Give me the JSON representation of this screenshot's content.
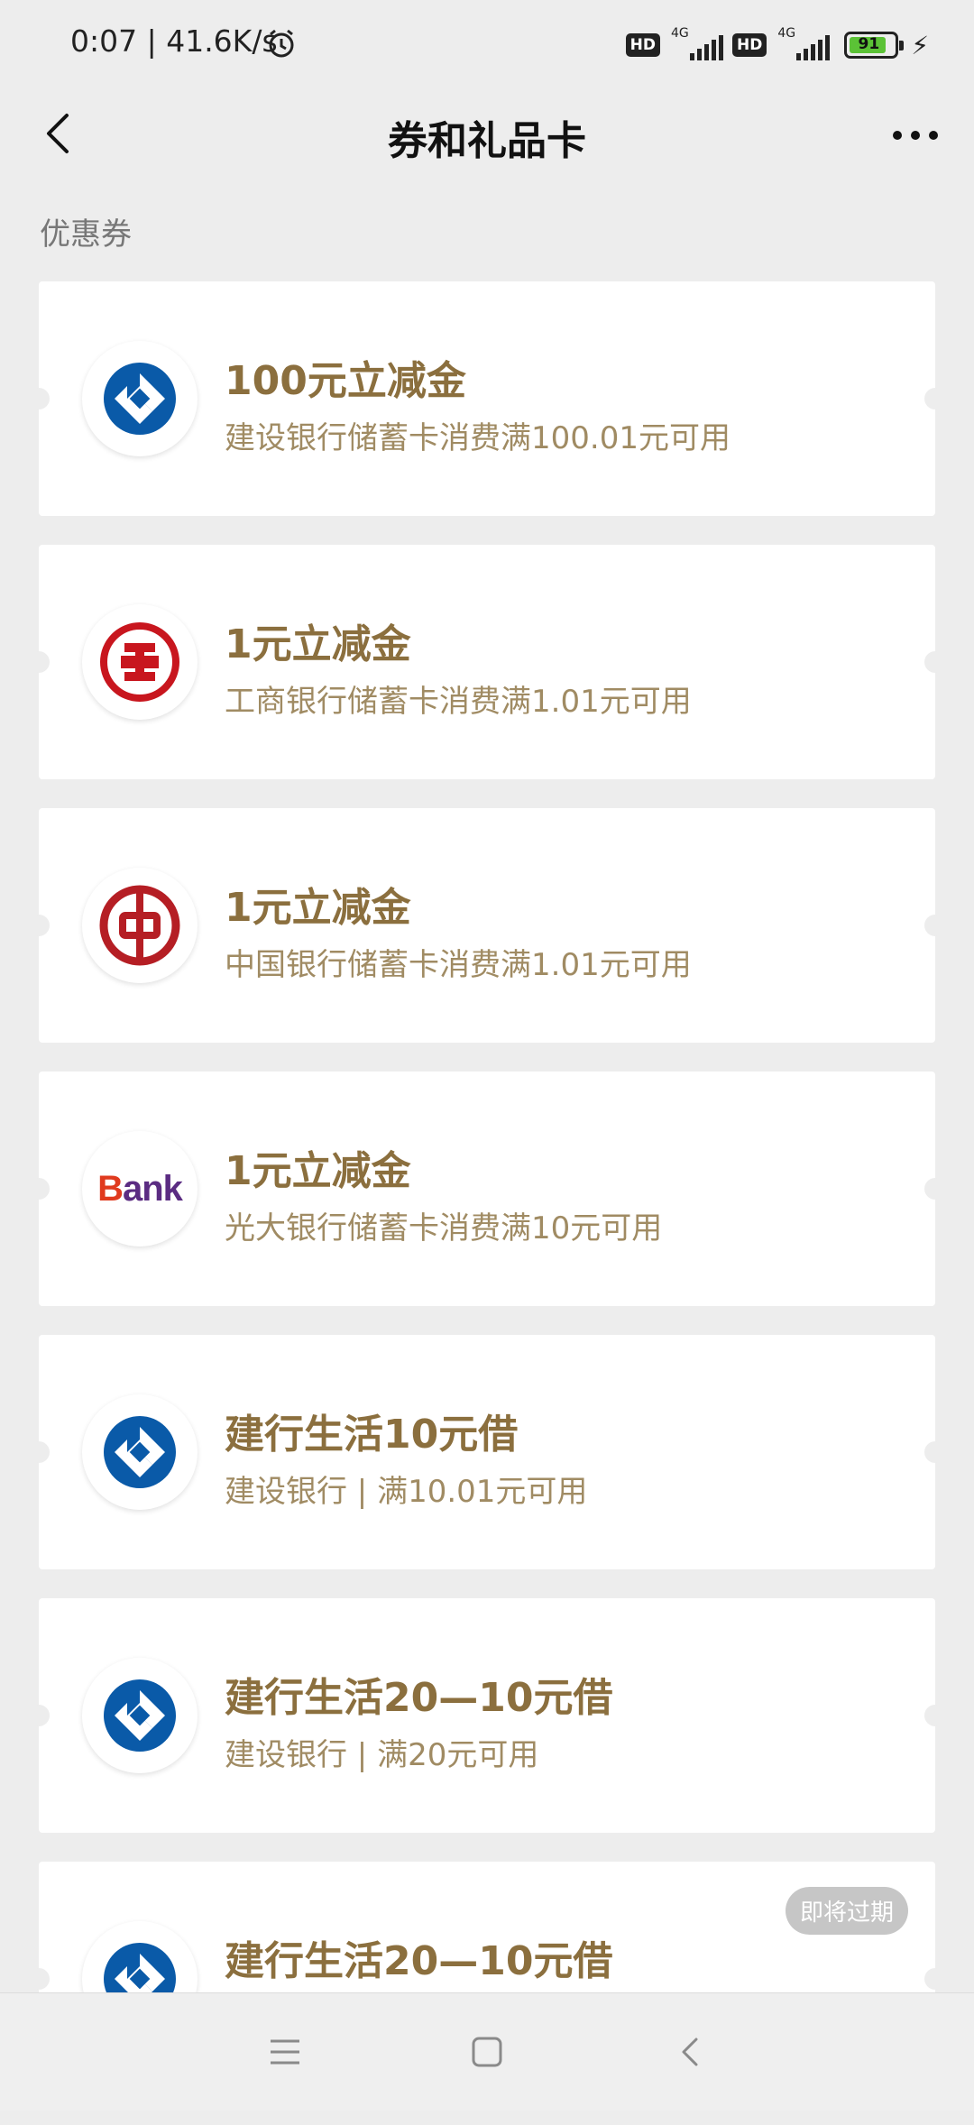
{
  "status_bar": {
    "time_speed": "0:07 | 41.6K/s",
    "hd1": "HD",
    "net1": "4G",
    "hd2": "HD",
    "net2": "4G",
    "battery": "91"
  },
  "nav": {
    "title": "券和礼品卡"
  },
  "section_label": "优惠券",
  "coupons": [
    {
      "title": "100元立减金",
      "desc": "建设银行储蓄卡消费满100.01元可用",
      "logo": "ccb-logo-icon"
    },
    {
      "title": "1元立减金",
      "desc": "工商银行储蓄卡消费满1.01元可用",
      "logo": "icbc-logo-icon"
    },
    {
      "title": "1元立减金",
      "desc": "中国银行储蓄卡消费满1.01元可用",
      "logo": "boc-logo-icon"
    },
    {
      "title": "1元立减金",
      "desc": "光大银行储蓄卡消费满10元可用",
      "logo": "ceb-bank-logo-icon",
      "logo_text_b": "B",
      "logo_text_rest": "ank"
    },
    {
      "title": "建行生活10元借",
      "desc": "建设银行 | 满10.01元可用",
      "logo": "ccb-logo-icon"
    },
    {
      "title": "建行生活20—10元借",
      "desc": "建设银行 | 满20元可用",
      "logo": "ccb-logo-icon"
    },
    {
      "title": "建行生活20—10元借",
      "desc": "",
      "logo": "ccb-logo-icon",
      "badge": "即将过期"
    }
  ],
  "colors": {
    "title": "#8b6f3e",
    "desc": "#a08b63",
    "ccb": "#0a5aa8",
    "icbc": "#c8161e",
    "boc": "#b51e24"
  }
}
